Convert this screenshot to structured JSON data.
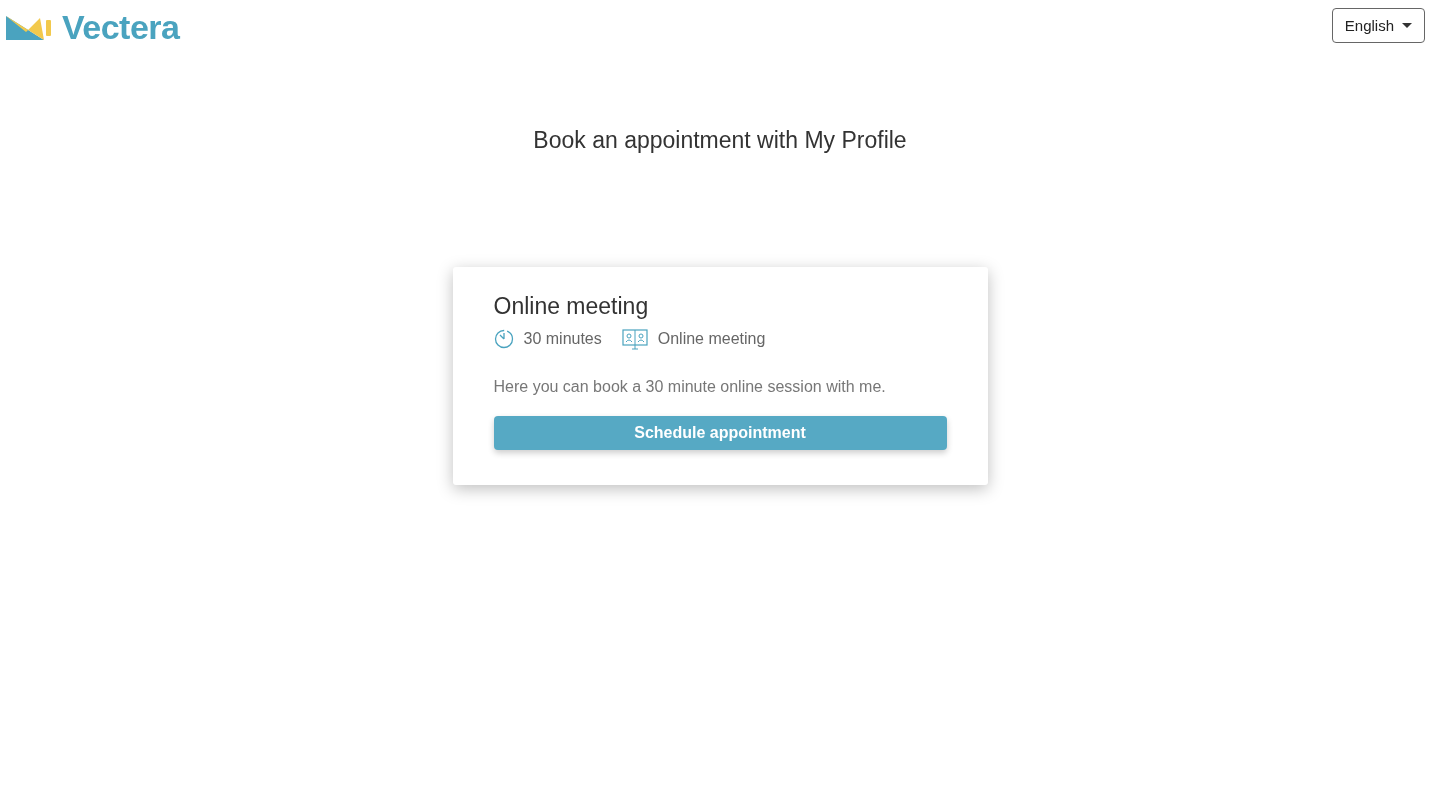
{
  "header": {
    "logo": "Vectera",
    "language": "English"
  },
  "heading": "Book an appointment with My Profile",
  "card": {
    "title": "Online meeting",
    "duration": "30 minutes",
    "location": "Online meeting",
    "description": "Here you can book a 30 minute online session with me.",
    "button": "Schedule appointment"
  }
}
